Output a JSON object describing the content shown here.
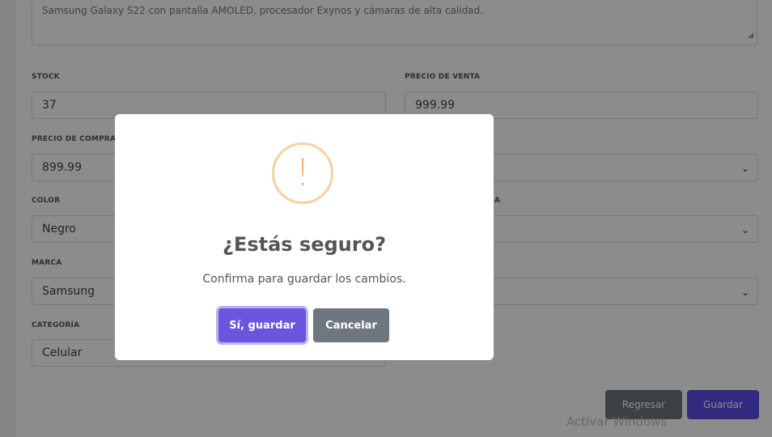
{
  "form": {
    "description_value": "Samsung Galaxy S22 con pantalla AMOLED, procesador Exynos y cámaras de alta calidad.",
    "stock_label": "STOCK",
    "stock_value": "37",
    "sale_price_label": "PRECIO DE VENTA",
    "sale_price_value": "999.99",
    "purchase_price_label": "PRECIO DE COMPRA",
    "purchase_price_value": "899.99",
    "color_label": "COLOR",
    "color_value": "Negro",
    "brand_label": "MARCA",
    "brand_value": "Samsung",
    "category_label": "CATEGORÍA",
    "category_value": "Celular",
    "partial_label_right": "A",
    "back_button": "Regresar",
    "save_button": "Guardar"
  },
  "watermark": "Activar Windows",
  "dialog": {
    "icon": "!",
    "title": "¿Estás seguro?",
    "text": "Confirma para guardar los cambios.",
    "confirm_label": "Sí, guardar",
    "cancel_label": "Cancelar"
  },
  "colors": {
    "primary": "#5a4de6",
    "secondary": "#6c757d",
    "warning": "#f8bb86"
  }
}
